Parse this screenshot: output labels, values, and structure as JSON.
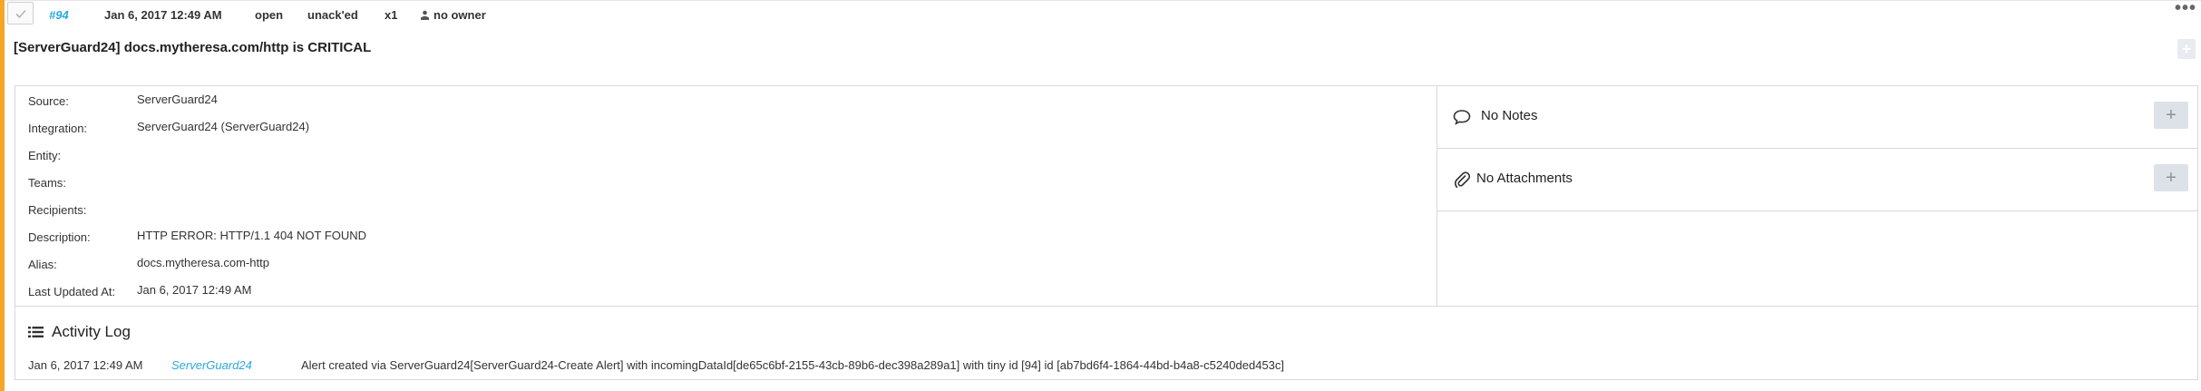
{
  "alert": {
    "tiny_id": "#94",
    "created_at": "Jan 6, 2017 12:49 AM",
    "status": "open",
    "ack_state": "unack'ed",
    "count": "x1",
    "owner": "no owner",
    "title": "[ServerGuard24] docs.mytheresa.com/http is CRITICAL",
    "more_label": "•••",
    "add_label": "+"
  },
  "details": [
    {
      "label": "Source:",
      "value": "ServerGuard24"
    },
    {
      "label": "Integration:",
      "value": "ServerGuard24 (ServerGuard24)"
    },
    {
      "label": "Entity:",
      "value": ""
    },
    {
      "label": "Teams:",
      "value": ""
    },
    {
      "label": "Recipients:",
      "value": ""
    },
    {
      "label": "Description:",
      "value": "HTTP ERROR: HTTP/1.1 404 NOT FOUND"
    },
    {
      "label": "Alias:",
      "value": "docs.mytheresa.com-http"
    },
    {
      "label": "Last Updated At:",
      "value": "Jan 6, 2017 12:49 AM"
    }
  ],
  "notes": {
    "label": "No Notes",
    "add_label": "+"
  },
  "attachments": {
    "label": "No Attachments",
    "add_label": "+"
  },
  "activity": {
    "title": "Activity Log",
    "entries": [
      {
        "date": "Jan 6, 2017 12:49 AM",
        "user": "ServerGuard24",
        "message": "Alert created via ServerGuard24[ServerGuard24-Create Alert] with incomingDataId[de65c6bf-2155-43cb-89b6-dec398a289a1] with tiny id [94] id [ab7bd6f4-1864-44bd-b4a8-c5240ded453c]"
      }
    ]
  },
  "colors": {
    "accent": "#f5a623",
    "link": "#29a8dd",
    "border": "#d9d9d9",
    "button_bg": "#dde2e8"
  },
  "icons": {
    "checkbox": "check-icon",
    "owner": "user-icon",
    "notes": "speech-bubble-icon",
    "attachments": "paperclip-icon",
    "activity": "list-icon",
    "more": "ellipsis-icon"
  }
}
